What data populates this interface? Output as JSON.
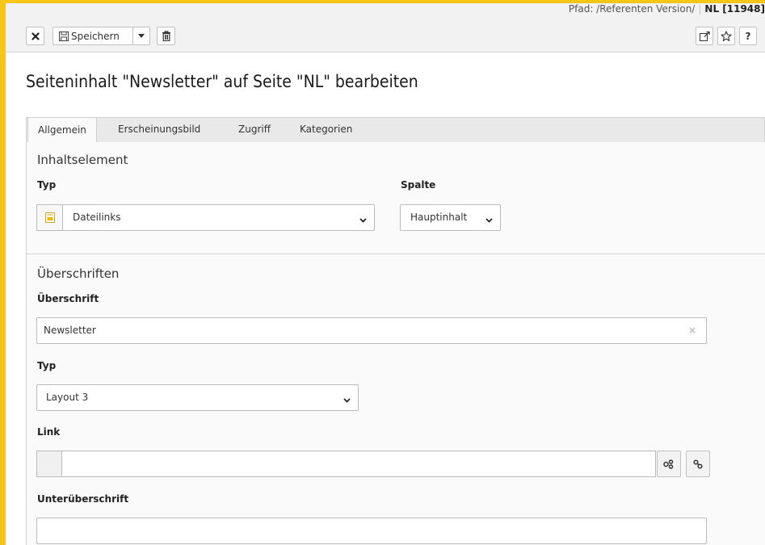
{
  "docheader": {
    "path_label": "Pfad: /Referenten Version/",
    "record_label": "NL [11948]",
    "save_label": "Speichern"
  },
  "page": {
    "title": "Seiteninhalt \"Newsletter\" auf Seite \"NL\" bearbeiten"
  },
  "tabs": [
    {
      "label": "Allgemein",
      "active": true
    },
    {
      "label": "Erscheinungsbild",
      "active": false
    },
    {
      "label": "Zugriff",
      "active": false
    },
    {
      "label": "Kategorien",
      "active": false
    }
  ],
  "content_element": {
    "section_title": "Inhaltselement",
    "type_label": "Typ",
    "type_value": "Dateilinks",
    "column_label": "Spalte",
    "column_value": "Hauptinhalt"
  },
  "headlines": {
    "section_title": "Überschriften",
    "headline_label": "Überschrift",
    "headline_value": "Newsletter",
    "headline_clear": "×",
    "type_label": "Typ",
    "type_value": "Layout 3",
    "link_label": "Link",
    "link_value": "",
    "subheadline_label": "Unterüberschrift",
    "subheadline_value": ""
  },
  "colors": {
    "frame": "#f5c518",
    "header_bg": "#f2f2f2",
    "panel_bg": "#fafafa"
  }
}
